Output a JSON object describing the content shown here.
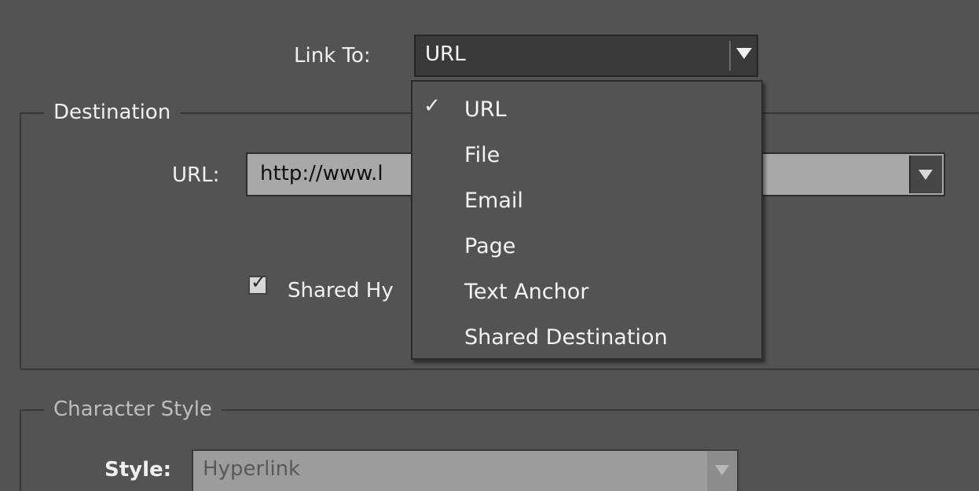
{
  "link_to": {
    "label": "Link To:",
    "selected": "URL"
  },
  "destination": {
    "legend": "Destination",
    "url_label": "URL:",
    "url_value": "http://www.l",
    "shared_checkbox_label": "Shared Hy",
    "shared_checked": true
  },
  "link_menu": {
    "check_glyph": "✓",
    "items": [
      {
        "label": "URL",
        "checked": true
      },
      {
        "label": "File",
        "checked": false
      },
      {
        "label": "Email",
        "checked": false
      },
      {
        "label": "Page",
        "checked": false
      },
      {
        "label": "Text Anchor",
        "checked": false
      },
      {
        "label": "Shared Destination",
        "checked": false
      }
    ]
  },
  "character_style": {
    "legend": "Character Style",
    "style_label": "Style:",
    "style_value": "Hyperlink"
  },
  "icons": {
    "dropdown_arrow": "chevron-down-icon",
    "checkbox_mark": "checkmark-icon"
  },
  "colors": {
    "panel_bg": "#535353",
    "field_dark": "#3a3a3a",
    "url_field": "#a8a8a8",
    "style_field_disabled": "#9c9c9c"
  }
}
